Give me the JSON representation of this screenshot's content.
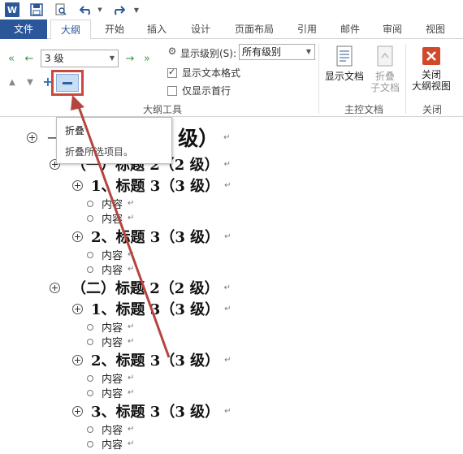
{
  "qat": {
    "logo_letter": "W",
    "icons": [
      "word-logo-icon",
      "save-icon",
      "print-preview-icon",
      "undo-icon",
      "redo-icon",
      "customize-qat-icon"
    ]
  },
  "tabs": [
    "文件",
    "大纲",
    "开始",
    "插入",
    "设计",
    "页面布局",
    "引用",
    "邮件",
    "审阅",
    "视图"
  ],
  "active_tab": "大纲",
  "ribbon": {
    "outline_tools": {
      "level_value": "3 级",
      "show_level_label": "显示级别(S):",
      "show_level_value": "所有级别",
      "show_text_format": "显示文本格式",
      "show_text_format_checked": true,
      "show_first_line_only": "仅显示首行",
      "show_first_line_only_checked": false,
      "group_label": "大纲工具"
    },
    "master_document": {
      "show_document": "显示文档",
      "collapse_subdocs_line1": "折叠",
      "collapse_subdocs_line2": "子文档",
      "group_label": "主控文档"
    },
    "close": {
      "close_line1": "关闭",
      "close_line2": "大纲视图",
      "group_label": "关闭"
    }
  },
  "tooltip": {
    "title": "折叠",
    "description": "折叠所选项目。"
  },
  "outline": {
    "h1": {
      "prefix": "—",
      "text": "（1 级）"
    },
    "h2_1": "（一）标题 2（2 级）",
    "h3_1": "1、标题 3（3 级）",
    "body_1": "内容",
    "body_2": "内容",
    "h3_2": "2、标题 3（3 级）",
    "body_3": "内容",
    "body_4": "内容",
    "h2_2": "（二）标题 2（2 级）",
    "h3_3": "1、标题 3（3 级）",
    "body_5": "内容",
    "body_6": "内容",
    "h3_4": "2、标题 3（3 级）",
    "body_7": "内容",
    "body_8": "内容",
    "h3_5": "3、标题 3（3 级）",
    "body_9": "内容",
    "body_10": "内容"
  },
  "colors": {
    "word_blue": "#2b579a",
    "accent_red": "#c8493e",
    "arrow_red": "#b5453d",
    "close_red": "#d04a2a"
  }
}
